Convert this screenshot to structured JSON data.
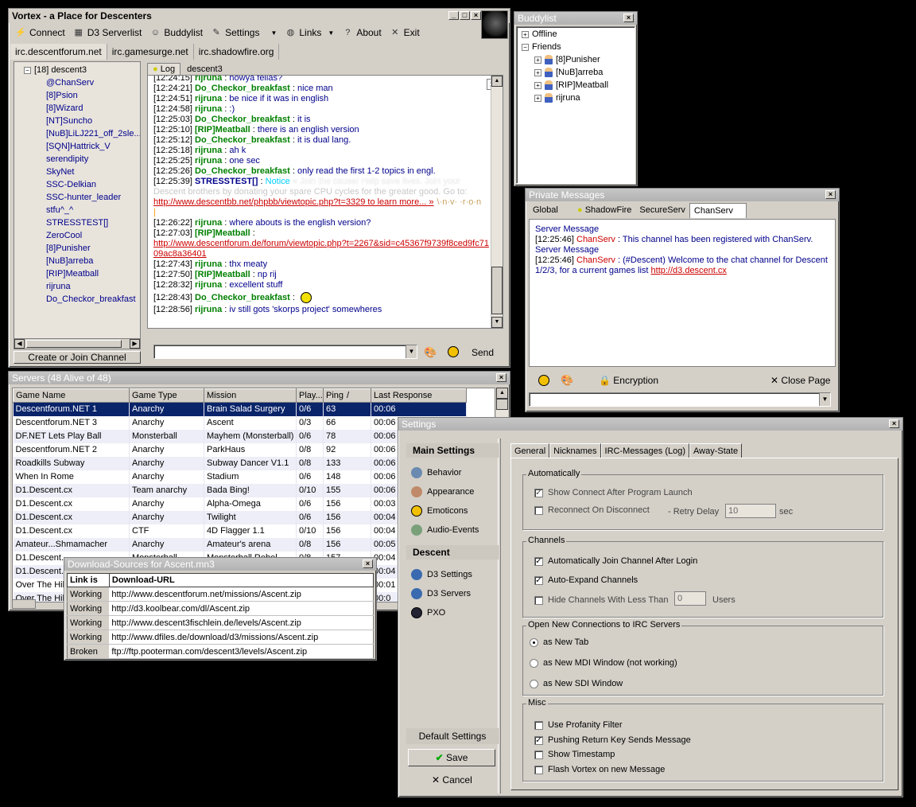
{
  "main": {
    "title": "Vortex - a Place for Descenters",
    "toolbar": {
      "connect": "Connect",
      "serverlist": "D3 Serverlist",
      "buddylist": "Buddylist",
      "settings": "Settings",
      "links": "Links",
      "about": "About",
      "exit": "Exit"
    },
    "servers": [
      "irc.descentforum.net",
      "irc.gamesurge.net",
      "irc.shadowfire.org"
    ],
    "tree_root": "[18] descent3",
    "users": [
      "@ChanServ",
      "[8]Psion",
      "[8]Wizard",
      "[NT]Suncho",
      "[NuB]LiLJ221_off_2sle...",
      "[SQN]Hattrick_V",
      "serendipity",
      "SkyNet",
      "SSC-Delkian",
      "SSC-hunter_leader",
      "stfu^_^",
      "STRESSTEST[]",
      "ZeroCool",
      "[8]Punisher",
      "[NuB]arreba",
      "[RIP]Meatball",
      "rijruna",
      "Do_Checkor_breakfast"
    ],
    "create_join": "Create or Join Channel",
    "tabs": {
      "log": "Log",
      "channel": "descent3"
    },
    "send": "Send",
    "chat": [
      {
        "t": "[12:24:15]",
        "u": "rijruna",
        "c": "u1",
        "m": "howya fellas?"
      },
      {
        "t": "[12:24:21]",
        "u": "Do_Checkor_breakfast",
        "c": "u1",
        "m": "nice man"
      },
      {
        "t": "[12:24:51]",
        "u": "rijruna",
        "c": "u1",
        "m": "be nice if it was in english"
      },
      {
        "t": "[12:24:58]",
        "u": "rijruna",
        "c": "u1",
        "m": ":)"
      },
      {
        "t": "[12:25:03]",
        "u": "Do_Checkor_breakfast",
        "c": "u1",
        "m": "it is"
      },
      {
        "t": "[12:25:10]",
        "u": "[RIP]Meatball",
        "c": "u1",
        "m": "there is an english version"
      },
      {
        "t": "[12:25:12]",
        "u": "Do_Checkor_breakfast",
        "c": "u1",
        "m": "it is dual lang."
      },
      {
        "t": "[12:25:18]",
        "u": "rijruna",
        "c": "u1",
        "m": "ah k"
      },
      {
        "t": "[12:25:25]",
        "u": "rijruna",
        "c": "u1",
        "m": "one sec"
      },
      {
        "t": "[12:25:26]",
        "u": "Do_Checkor_breakfast",
        "c": "u1",
        "m": "only read the first 1-2 topics in engl."
      }
    ],
    "notice": {
      "t": "[12:25:39]",
      "u": "STRESSTEST[]",
      "tag": "Notice",
      "m1": "« Join the cause! Help save lives. Join your",
      "m2": "Descent brothers by donating your spare CPU cycles for the greater good. Go to:",
      "url": "http://www.descentbb.net/phpbb/viewtopic.php?t=3329 to learn more... »",
      "tail": "\\·n·v·  ·r·o·n"
    },
    "chat2": [
      {
        "t": "[12:26:22]",
        "u": "rijruna",
        "m": "where abouts is the english version?"
      },
      {
        "t": "[12:27:03]",
        "u": "[RIP]Meatball",
        "m": ""
      }
    ],
    "url2a": "http://www.descentforum.de/forum/viewtopic.php?t=2267&sid=c45367f9739f8ced9fc71",
    "url2b": "09ac8a36401",
    "chat3": [
      {
        "t": "[12:27:43]",
        "u": "rijruna",
        "m": "thx meaty"
      },
      {
        "t": "[12:27:50]",
        "u": "[RIP]Meatball",
        "m": "np rij"
      },
      {
        "t": "[12:28:32]",
        "u": "rijruna",
        "m": "excellent stuff"
      },
      {
        "t": "[12:28:43]",
        "u": "Do_Checkor_breakfast",
        "m": ""
      },
      {
        "t": "[12:28:56]",
        "u": "rijruna",
        "m": "iv still gots 'skorps project' somewheres"
      }
    ]
  },
  "serverwin": {
    "title": "Servers (48 Alive of 48)",
    "cols": [
      "Game Name",
      "Game Type",
      "Mission",
      "Play...",
      "Ping",
      "Last Response"
    ],
    "sort_glyph": "/",
    "rows": [
      [
        "Descentforum.NET 1",
        "Anarchy",
        "Brain Salad Surgery",
        "0/6",
        "63",
        "00:06"
      ],
      [
        "Descentforum.NET 3",
        "Anarchy",
        "Ascent",
        "0/3",
        "66",
        "00:06"
      ],
      [
        "DF.NET Lets Play Ball",
        "Monsterball",
        "Mayhem (Monsterball)",
        "0/6",
        "78",
        "00:06"
      ],
      [
        "Descentforum.NET 2",
        "Anarchy",
        "ParkHaus",
        "0/8",
        "92",
        "00:06"
      ],
      [
        "Roadkills Subway",
        "Anarchy",
        "Subway Dancer V1.1",
        "0/8",
        "133",
        "00:06"
      ],
      [
        "When In Rome",
        "Anarchy",
        "Stadium",
        "0/6",
        "148",
        "00:06"
      ],
      [
        "D1.Descent.cx",
        "Team anarchy",
        "Bada Bing!",
        "0/10",
        "155",
        "00:06"
      ],
      [
        "D1.Descent.cx",
        "Anarchy",
        "Alpha-Omega",
        "0/6",
        "156",
        "00:03"
      ],
      [
        "D1.Descent.cx",
        "Anarchy",
        "Twilight",
        "0/6",
        "156",
        "00:04"
      ],
      [
        "D1.Descent.cx",
        "CTF",
        "4D Flagger 1.1",
        "0/10",
        "156",
        "00:04"
      ],
      [
        "Amateur...Shmamacher",
        "Anarchy",
        "Amateur's arena",
        "0/8",
        "156",
        "00:05"
      ],
      [
        "D1.Descent...",
        "Monsterball",
        "Monsterball Rebel...",
        "0/8",
        "157",
        "00:04"
      ],
      [
        "D1.Descent...",
        "",
        "",
        "",
        "",
        "00:04"
      ],
      [
        "Over The Hill",
        "",
        "",
        "",
        "",
        "00:01"
      ],
      [
        "Over The Hill",
        "",
        "",
        "",
        "",
        "00:0"
      ]
    ]
  },
  "download": {
    "title": "Download-Sources for Ascent.mn3",
    "cols": [
      "Link is",
      "Download-URL"
    ],
    "rows": [
      [
        "Working",
        "http://www.descentforum.net/missions/Ascent.zip"
      ],
      [
        "Working",
        "http://d3.koolbear.com/dl/Ascent.zip"
      ],
      [
        "Working",
        "http://www.descent3fischlein.de/levels/Ascent.zip"
      ],
      [
        "Working",
        "http://www.dfiles.de/download/d3/missions/Ascent.zip"
      ],
      [
        "Broken",
        "ftp://ftp.pooterman.com/descent3/levels/Ascent.zip"
      ]
    ]
  },
  "buddy": {
    "title": "Buddylist",
    "offline": "Offline",
    "friends": "Friends",
    "list": [
      "[8]Punisher",
      "[NuB]arreba",
      "[RIP]Meatball",
      "rijruna"
    ]
  },
  "pm": {
    "title": "Private Messages",
    "tabs": [
      "Global",
      "ShadowFire",
      "SecureServ",
      "ChanServ"
    ],
    "lines": [
      {
        "h": "Server Message"
      },
      {
        "t": "[12:25:46]",
        "u": "ChanServ",
        "m": ": This channel has been registered with ChanServ."
      },
      {
        "h": "Server Message"
      },
      {
        "t": "[12:25:46]",
        "u": "ChanServ",
        "m": ": (#Descent) Welcome to the chat channel for Descent"
      }
    ],
    "cont": "1/2/3, for a current games list",
    "url": "http://d3.descent.cx",
    "encryption": "Encryption",
    "close": "Close Page"
  },
  "settings": {
    "title": "Settings",
    "main_h": "Main Settings",
    "main_items": [
      "Behavior",
      "Appearance",
      "Emoticons",
      "Audio-Events"
    ],
    "descent_h": "Descent",
    "descent_items": [
      "D3 Settings",
      "D3 Servers",
      "PXO"
    ],
    "default": "Default Settings",
    "save": "Save",
    "cancel": "Cancel",
    "tabs": [
      "General",
      "Nicknames",
      "IRC-Messages (Log)",
      "Away-State"
    ],
    "g_auto": "Automatically",
    "show_connect": "Show Connect After Program Launch",
    "reconnect": "Reconnect On Disconnect",
    "retry": "- Retry Delay",
    "retry_val": "10",
    "sec": "sec",
    "g_chan": "Channels",
    "auto_join": "Automatically Join Channel After Login",
    "auto_expand": "Auto-Expand Channels",
    "hide_less": "Hide Channels With Less Than",
    "hide_val": "0",
    "users": "Users",
    "g_open": "Open New Connections to IRC Servers",
    "as_tab": "as New Tab",
    "as_mdi": "as New MDI Window (not working)",
    "as_sdi": "as New SDI Window",
    "g_misc": "Misc",
    "profanity": "Use Profanity Filter",
    "return_key": "Pushing Return Key Sends Message",
    "timestamp": "Show Timestamp",
    "flash": "Flash Vortex on new Message"
  }
}
